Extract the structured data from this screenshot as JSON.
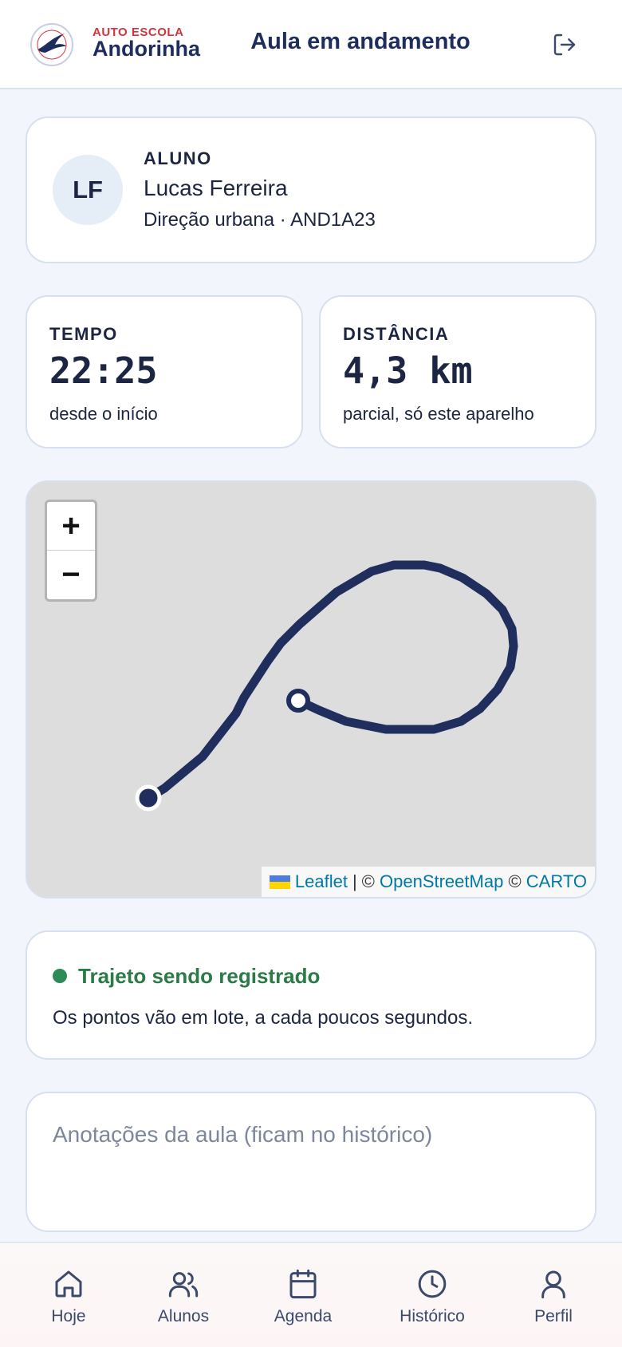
{
  "header": {
    "brand_top": "AUTO ESCOLA",
    "brand_name": "Andorinha",
    "title": "Aula em andamento",
    "icons": {
      "logo": "swallow-logo-icon",
      "logout": "logout-icon"
    }
  },
  "student": {
    "initials": "LF",
    "label": "ALUNO",
    "name": "Lucas Ferreira",
    "detail": "Direção urbana · AND1A23"
  },
  "stats": {
    "time": {
      "label": "TEMPO",
      "value": "22:25",
      "note": "desde o início"
    },
    "distance": {
      "label": "DISTÂNCIA",
      "value": "4,3 km",
      "note": "parcial, só este aparelho"
    }
  },
  "map": {
    "zoom_in": "+",
    "zoom_out": "−",
    "attribution": {
      "leaflet": "Leaflet",
      "separator": "|",
      "copy1": "©",
      "osm": "OpenStreetMap",
      "copy2": "©",
      "carto": "CARTO"
    },
    "route_color": "#1f2e5c",
    "background_color": "#dddddd"
  },
  "status": {
    "title": "Trajeto sendo registrado",
    "description": "Os pontos vão em lote, a cada poucos segundos.",
    "color": "#2b7a48"
  },
  "notes": {
    "placeholder": "Anotações da aula (ficam no histórico)",
    "value": ""
  },
  "nav": {
    "items": [
      {
        "label": "Hoje",
        "icon": "home-icon"
      },
      {
        "label": "Alunos",
        "icon": "users-icon"
      },
      {
        "label": "Agenda",
        "icon": "calendar-icon"
      },
      {
        "label": "Histórico",
        "icon": "clock-icon"
      },
      {
        "label": "Perfil",
        "icon": "user-icon"
      }
    ]
  },
  "colors": {
    "brand": "#1e2d5c",
    "accent": "#d2343e",
    "page_bg": "#f2f6fc"
  }
}
